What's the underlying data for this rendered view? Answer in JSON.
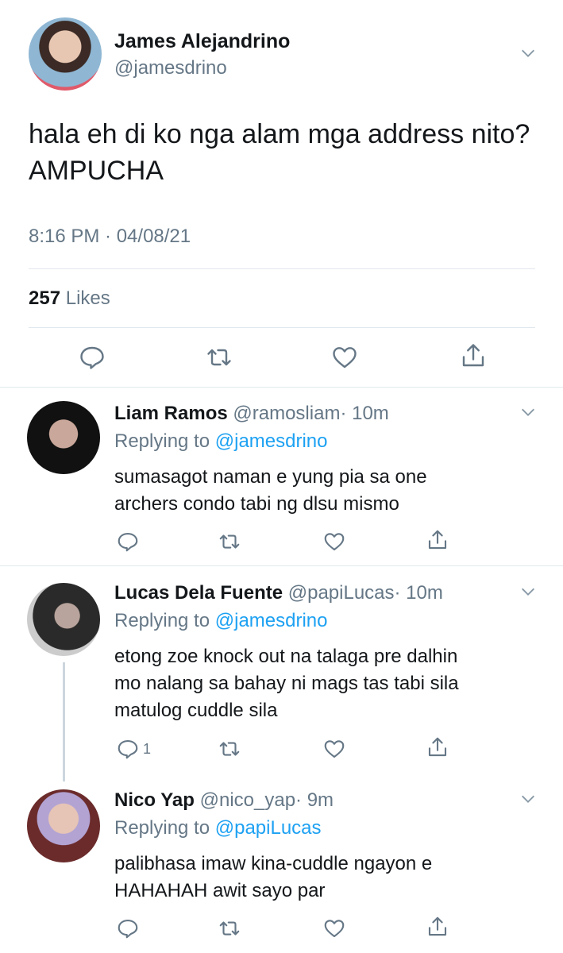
{
  "main_tweet": {
    "name": "James Alejandrino",
    "handle": "@jamesdrino",
    "text": "hala eh di ko nga alam mga address nito? AMPUCHA",
    "timestamp": "8:16 PM · 04/08/21",
    "likes_count": "257",
    "likes_label": "Likes"
  },
  "replies": [
    {
      "name": "Liam Ramos",
      "handle": "@ramosliam",
      "time": "· 10m",
      "replying_prefix": "Replying to",
      "replying_to": "@jamesdrino",
      "line1": "sumasagot naman e yung pia sa one",
      "line2": "archers condo tabi ng dlsu mismo",
      "line3": "",
      "reply_count": ""
    },
    {
      "name": "Lucas Dela Fuente",
      "handle": "@papiLucas",
      "time": "· 10m",
      "replying_prefix": "Replying to",
      "replying_to": "@jamesdrino",
      "line1": "etong zoe knock out na talaga pre dalhin",
      "line2": "mo nalang sa bahay ni mags tas tabi sila",
      "line3": "matulog cuddle sila",
      "reply_count": "1"
    },
    {
      "name": "Nico Yap",
      "handle": "@nico_yap",
      "time": "· 9m",
      "replying_prefix": "Replying to",
      "replying_to": "@papiLucas",
      "line1": "palibhasa imaw kina-cuddle ngayon e",
      "line2": "HAHAHAH awit sayo par",
      "line3": "",
      "reply_count": ""
    }
  ],
  "icons": [
    "chevron-down-icon",
    "reply-icon",
    "retweet-icon",
    "like-icon",
    "share-icon"
  ],
  "colors": {
    "link": "#1da1f2",
    "secondary": "#657786",
    "divider": "#e1e8ed"
  }
}
